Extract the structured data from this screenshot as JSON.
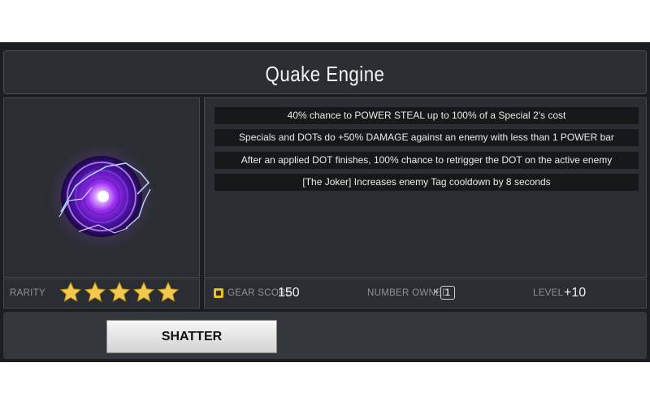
{
  "item": {
    "name": "Quake Engine"
  },
  "effects": [
    "40%  chance to POWER STEAL up to 100% of a Special 2's cost",
    "Specials and DOTs do +50% DAMAGE against an enemy with less than 1 POWER bar",
    "After an applied DOT finishes, 100% chance to retrigger the DOT on the active enemy",
    "[The Joker] Increases enemy Tag cooldown by 8 seconds"
  ],
  "rarity": {
    "label": "RARITY",
    "stars": 5,
    "icon": "star-icon",
    "color": "#f2c94c"
  },
  "gear_score": {
    "label": "GEAR SCORE",
    "value": "150",
    "icon": "gear-score-icon",
    "icon_color": "#e8c21a"
  },
  "number_owned": {
    "label": "NUMBER OWNED",
    "prefix": "×",
    "value": "1"
  },
  "level": {
    "label": "LEVEL",
    "value": "+10"
  },
  "actions": {
    "shatter_label": "SHATTER"
  }
}
